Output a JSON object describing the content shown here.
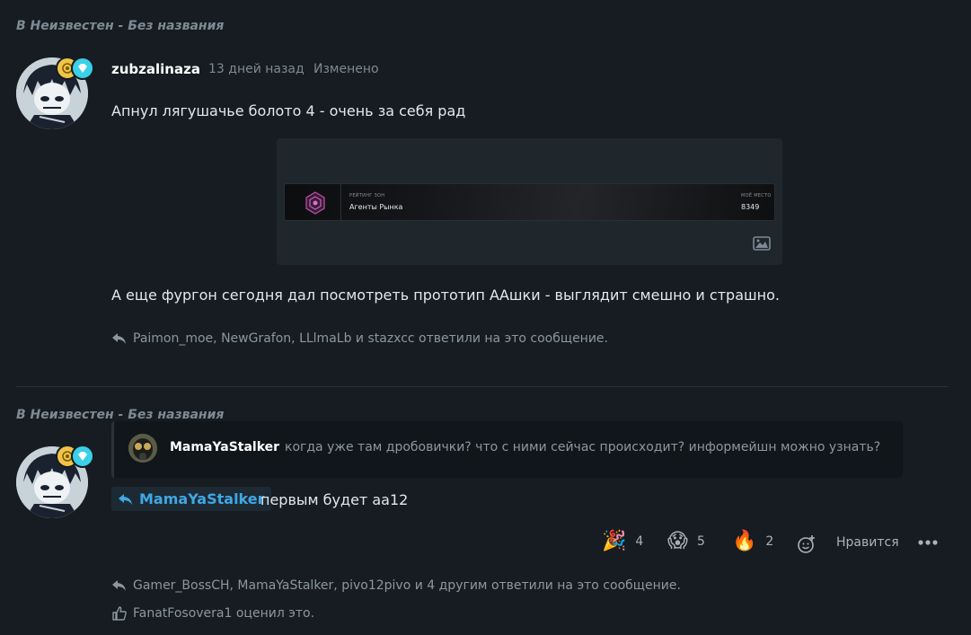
{
  "post1": {
    "context": "В Неизвестен - Без названия",
    "author": "zubzalinaza",
    "time": "13 дней назад",
    "edited": "Изменено",
    "text1": "Апнул лягушачье болото 4 - очень за себя рад",
    "embed": {
      "rank_label": "РЕЙТИНГ ЗОН",
      "rank_name": "Агенты Рынка",
      "score_label": "МОЁ МЕСТО",
      "score_value": "8349",
      "image_icon": "image-icon"
    },
    "text2": "А еще фургон сегодня дал посмотреть прототип ААшки - выглядит смешно и страшно.",
    "replied": "Paimon_moe, NewGrafon, LLlmaLb и stazxcc ответили на это сообщение."
  },
  "post2": {
    "context": "В Неизвестен - Без названия",
    "quote": {
      "author": "MamaYaStalker",
      "text": "когда уже там дробовички? что с ними сейчас происходит? информейшн можно узнать?"
    },
    "mention": "MamaYaStalker",
    "text": "первым будет аа12",
    "reactions": [
      {
        "emoji": "🎉",
        "count": "4"
      },
      {
        "emoji": "😱",
        "count": "5"
      },
      {
        "emoji": "🔥",
        "count": "2"
      }
    ],
    "like_label": "Нравится",
    "more_icon": "more-icon",
    "replied": "Gamer_BossCH, MamaYaStalker, pivo12pivo и 4 другим ответили на это сообщение.",
    "rated": "FanatFosovera1 оценил это."
  },
  "colors": {
    "background": "#161c21",
    "accent": "#3fa8e6",
    "muted": "#7e8a94"
  }
}
